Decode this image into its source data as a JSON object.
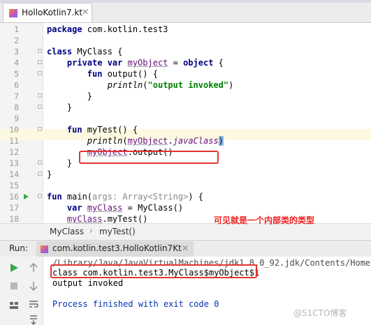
{
  "tab": {
    "file_name": "HolloKotlin7.kt",
    "close_glyph": "✕",
    "icon": "kotlin-file-icon"
  },
  "code_lines": [
    {
      "num": "1",
      "tokens": [
        {
          "t": "package ",
          "c": "kw"
        },
        {
          "t": "com.kotlin.test3",
          "c": ""
        }
      ]
    },
    {
      "num": "2",
      "tokens": []
    },
    {
      "num": "3",
      "tokens": [
        {
          "t": "class ",
          "c": "kw"
        },
        {
          "t": "MyClass {",
          "c": ""
        }
      ]
    },
    {
      "num": "4",
      "tokens": [
        {
          "t": "    private var ",
          "c": "kw"
        },
        {
          "t": "myObject",
          "c": "prop"
        },
        {
          "t": " = ",
          "c": ""
        },
        {
          "t": "object",
          "c": "kw"
        },
        {
          "t": " {",
          "c": ""
        }
      ]
    },
    {
      "num": "5",
      "tokens": [
        {
          "t": "        fun ",
          "c": "kw"
        },
        {
          "t": "output() {",
          "c": ""
        }
      ]
    },
    {
      "num": "6",
      "tokens": [
        {
          "t": "            ",
          "c": ""
        },
        {
          "t": "println",
          "c": "fn-italic"
        },
        {
          "t": "(",
          "c": ""
        },
        {
          "t": "\"output invoked\"",
          "c": "str"
        },
        {
          "t": ")",
          "c": ""
        }
      ]
    },
    {
      "num": "7",
      "tokens": [
        {
          "t": "        }",
          "c": ""
        }
      ]
    },
    {
      "num": "8",
      "tokens": [
        {
          "t": "    }",
          "c": ""
        }
      ]
    },
    {
      "num": "9",
      "tokens": []
    },
    {
      "num": "10",
      "tokens": [
        {
          "t": "    fun ",
          "c": "kw"
        },
        {
          "t": "myTest() {",
          "c": ""
        }
      ]
    },
    {
      "num": "11",
      "tokens": [
        {
          "t": "        ",
          "c": ""
        },
        {
          "t": "println",
          "c": "fn-italic"
        },
        {
          "t": "(",
          "c": ""
        },
        {
          "t": "myObject",
          "c": "prop"
        },
        {
          "t": ".",
          "c": ""
        },
        {
          "t": "javaClass",
          "c": "ital-prop"
        },
        {
          "t": ")",
          "c": "paren-match"
        }
      ]
    },
    {
      "num": "12",
      "tokens": [
        {
          "t": "        ",
          "c": ""
        },
        {
          "t": "myObject",
          "c": "prop"
        },
        {
          "t": ".output()",
          "c": ""
        }
      ]
    },
    {
      "num": "13",
      "tokens": [
        {
          "t": "    }",
          "c": ""
        }
      ]
    },
    {
      "num": "14",
      "tokens": [
        {
          "t": "}",
          "c": ""
        }
      ]
    },
    {
      "num": "15",
      "tokens": []
    },
    {
      "num": "16",
      "tokens": [
        {
          "t": "fun ",
          "c": "kw"
        },
        {
          "t": "main(",
          "c": ""
        },
        {
          "t": "args: Array<String>",
          "c": "hint"
        },
        {
          "t": ") {",
          "c": ""
        }
      ]
    },
    {
      "num": "17",
      "tokens": [
        {
          "t": "    ",
          "c": ""
        },
        {
          "t": "var ",
          "c": "kw"
        },
        {
          "t": "myClass",
          "c": "prop"
        },
        {
          "t": " = MyClass()",
          "c": ""
        }
      ]
    },
    {
      "num": "18",
      "tokens": [
        {
          "t": "    ",
          "c": ""
        },
        {
          "t": "myClass",
          "c": "prop"
        },
        {
          "t": ".myTest()",
          "c": ""
        }
      ]
    },
    {
      "num": "19",
      "tokens": [
        {
          "t": "}",
          "c": ""
        }
      ]
    }
  ],
  "breadcrumb": {
    "items": [
      "MyClass",
      "myTest()"
    ],
    "separator": "›"
  },
  "annotation": {
    "text": "可见就是一个内部类的类型"
  },
  "run_panel": {
    "label": "Run:",
    "config_name": "com.kotlin.test3.HolloKotlin7Kt",
    "close_glyph": "✕",
    "console_lines": [
      {
        "text": "/Library/Java/JavaVirtualMachines/jdk1.8.0_92.jdk/Contents/Home/b",
        "kind": "path"
      },
      {
        "text": "class com.kotlin.test3.MyClass$myObject$1",
        "kind": "out"
      },
      {
        "text": "output invoked",
        "kind": "out"
      },
      {
        "text": "",
        "kind": "out"
      },
      {
        "text": "Process finished with exit code 0",
        "kind": "exit"
      }
    ]
  },
  "watermark": "@51CTO博客",
  "colors": {
    "keyword": "#000080",
    "property": "#660e7a",
    "string": "#008000",
    "highlight_box": "#e3342f",
    "annotation": "#f02020"
  }
}
